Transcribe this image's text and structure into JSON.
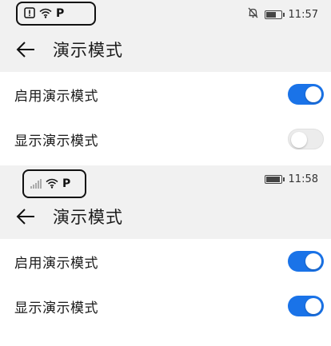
{
  "screens": [
    {
      "status": {
        "time": "11:57",
        "left_icons": [
          "warning-icon",
          "wifi-icon",
          "parking-p-icon"
        ],
        "right_icons": [
          "mute-bell-icon",
          "battery-icon"
        ],
        "battery_level": 0.7
      },
      "header": {
        "title": "演示模式"
      },
      "settings": [
        {
          "label": "启用演示模式",
          "enabled": true
        },
        {
          "label": "显示演示模式",
          "enabled": false
        }
      ]
    },
    {
      "status": {
        "time": "11:58",
        "left_icons": [
          "signal-icon",
          "wifi-icon",
          "parking-p-icon"
        ],
        "right_icons": [
          "battery-icon"
        ],
        "battery_level": 0.95
      },
      "header": {
        "title": "演示模式"
      },
      "settings": [
        {
          "label": "启用演示模式",
          "enabled": true
        },
        {
          "label": "显示演示模式",
          "enabled": true
        }
      ]
    }
  ],
  "parking_icon_text": "P",
  "colors": {
    "toggle_on": "#1a73e8",
    "toggle_off": "#ececec",
    "background": "#f1f1f1",
    "list_bg": "#ffffff"
  }
}
